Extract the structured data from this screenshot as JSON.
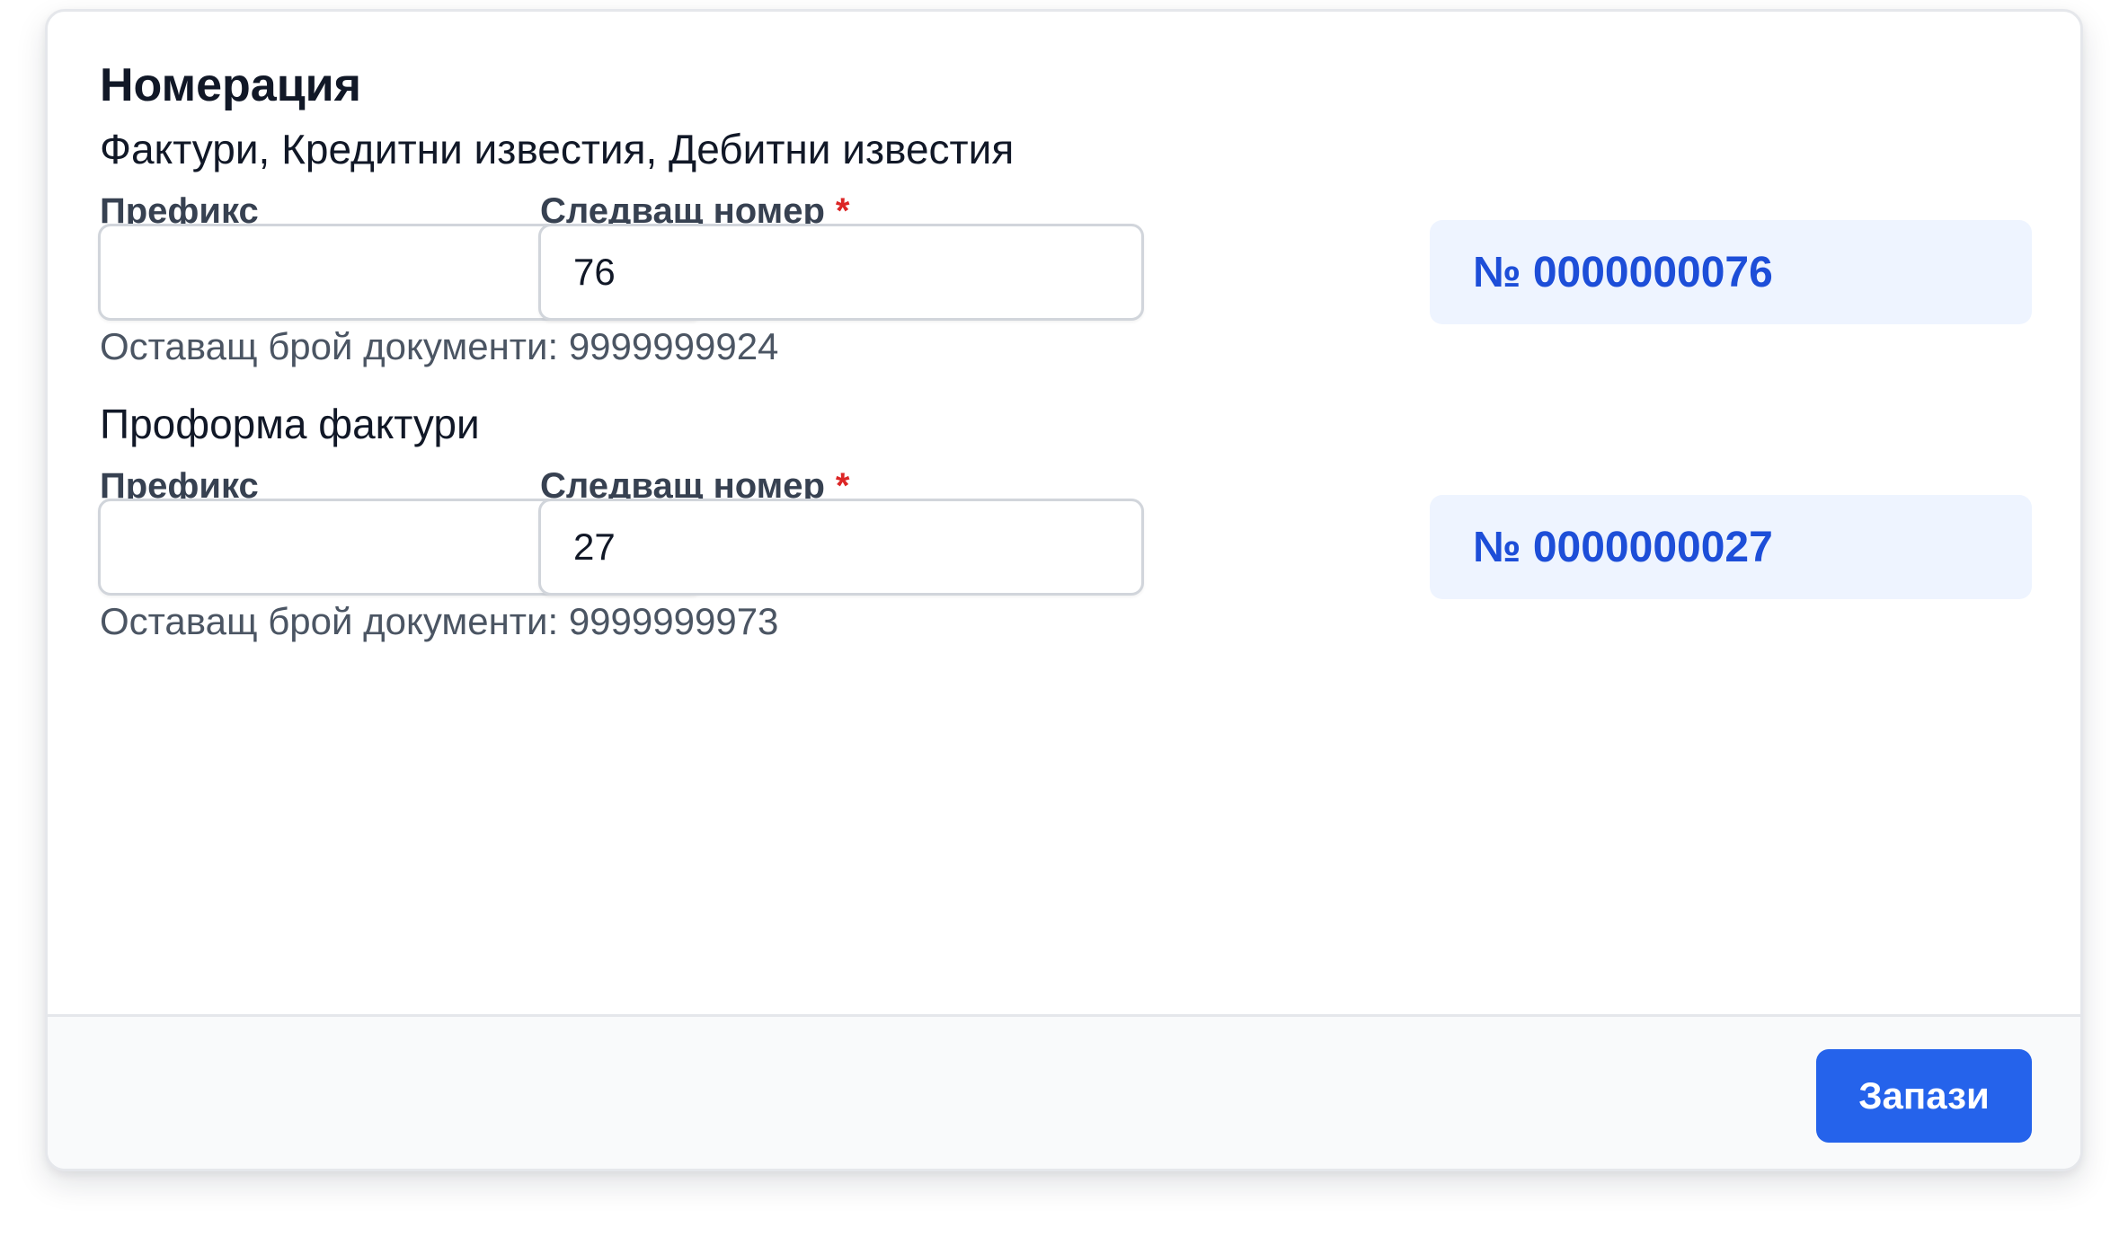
{
  "page": {
    "title": "Номерация"
  },
  "invoices": {
    "section_title": "Фактури, Кредитни известия, Дебитни известия",
    "prefix_label": "Префикс",
    "prefix_value": "",
    "next_number_label": "Следващ номер",
    "required_marker": "*",
    "next_number_value": "76",
    "preview": "№ 0000000076",
    "remaining": "Оставащ брой документи: 9999999924"
  },
  "proforma": {
    "section_title": "Проформа фактури",
    "prefix_label": "Префикс",
    "prefix_value": "",
    "next_number_label": "Следващ номер",
    "required_marker": "*",
    "next_number_value": "27",
    "preview": "№ 0000000027",
    "remaining": "Оставащ брой документи: 9999999973"
  },
  "footer": {
    "save_label": "Запази"
  },
  "colors": {
    "accent": "#2563eb",
    "preview_text": "#1d4ed8",
    "preview_bg": "#eef4ff",
    "required": "#dc2626"
  }
}
